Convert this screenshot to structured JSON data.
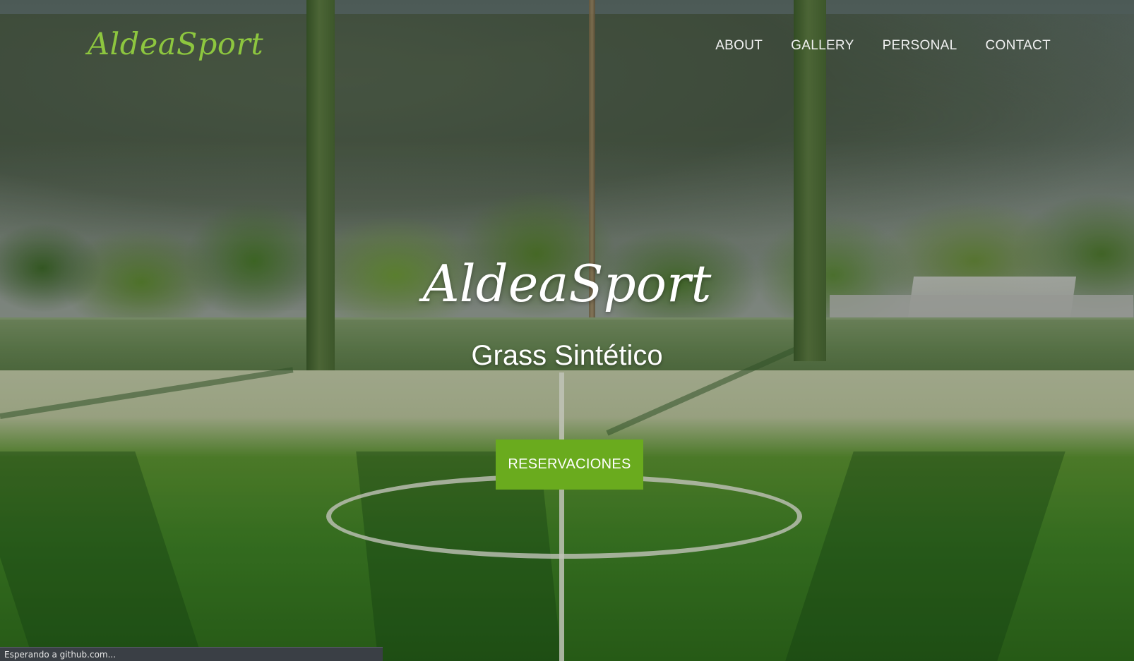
{
  "navbar": {
    "brand": "AldeaSport",
    "links": [
      {
        "label": "ABOUT"
      },
      {
        "label": "GALLERY"
      },
      {
        "label": "PERSONAL"
      },
      {
        "label": "CONTACT"
      }
    ]
  },
  "hero": {
    "title": "AldeaSport",
    "subtitle": "Grass Sintético",
    "cta_label": "RESERVACIONES"
  },
  "status_bar": {
    "text": "Esperando a github.com..."
  },
  "colors": {
    "brand_green": "#8dc63f",
    "cta_green": "#6aab1e",
    "status_bar_bg": "#3a3f45"
  }
}
